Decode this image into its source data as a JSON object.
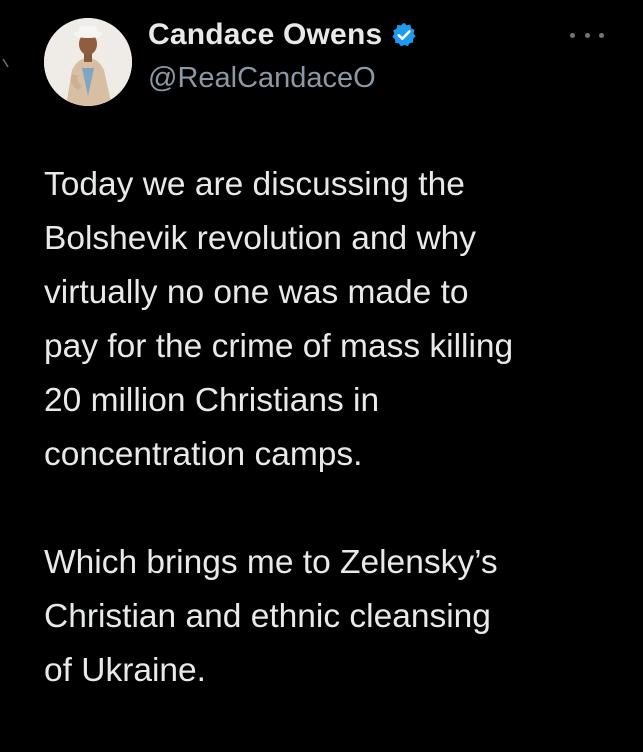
{
  "tweet": {
    "author": {
      "display_name": "Candace Owens",
      "handle": "@RealCandaceO",
      "verified": true,
      "verified_color": "#1d9bf0",
      "avatar_icon": "avatar-photo"
    },
    "more_icon": "more-horizontal-icon",
    "paragraphs": [
      "Today we are discussing the\nBolshevik revolution and why\nvirtually no one was made to\npay for the crime of mass killing\n20 million Christians in\nconcentration camps.",
      "Which brings me to Zelensky’s\nChristian and ethnic cleansing\nof Ukraine."
    ]
  },
  "colors": {
    "background": "#000000",
    "primary_text": "#e7e9ea",
    "secondary_text": "#8b98a5",
    "icon_gray": "#71767b"
  }
}
